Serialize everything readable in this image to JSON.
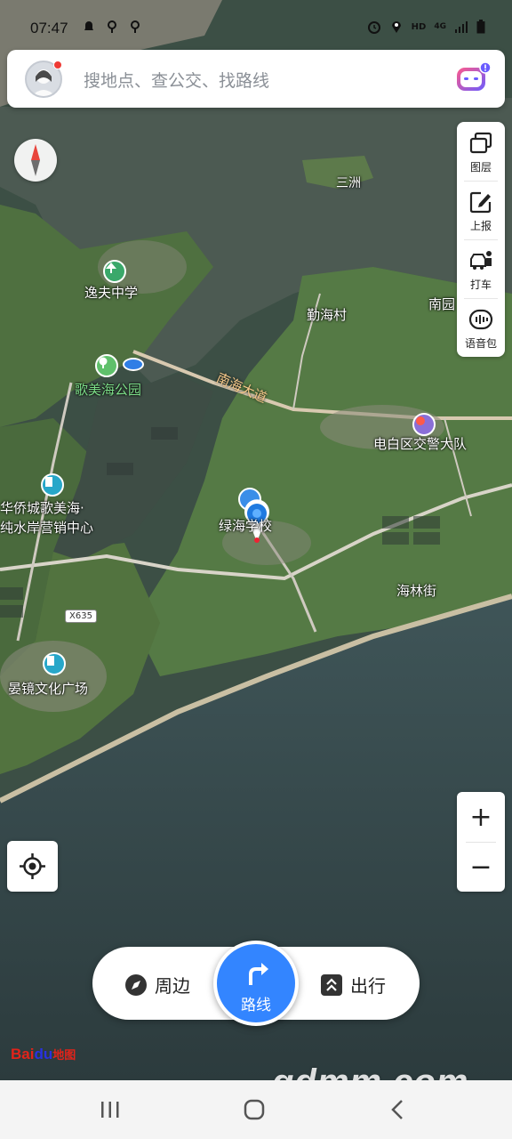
{
  "status_bar": {
    "time": "07:47",
    "left_icons": [
      "notification-icon",
      "location-pin-icon",
      "location-pin-icon"
    ],
    "right_icons": [
      "alarm-icon",
      "location-icon",
      "hd-icon",
      "4g-icon",
      "signal-icon",
      "battery-icon"
    ],
    "hd": "HD",
    "network": "4G"
  },
  "search": {
    "placeholder": "搜地点、查公交、找路线"
  },
  "toolbar": {
    "items": [
      {
        "label": "图层",
        "icon": "layers-icon"
      },
      {
        "label": "上报",
        "icon": "report-icon"
      },
      {
        "label": "打车",
        "icon": "taxi-icon"
      },
      {
        "label": "语音包",
        "icon": "voice-pack-icon"
      }
    ]
  },
  "map": {
    "labels": {
      "sanzhou": "三洲",
      "yifu_school": "逸夫中学",
      "qinhai_village": "勤海村",
      "nanyuan": "南园",
      "gemeihai_park": "歌美海公园",
      "nanhai_road": "南海大道",
      "traffic_police": "电白区交警大队",
      "huaqiao_line1": "华侨城歌美海·",
      "huaqiao_line2": "纯水岸营销中心",
      "lvhai_school": "绿海学校",
      "hailinjie": "海林街",
      "road_x635": "X635",
      "yanjing_plaza": "晏镜文化广场"
    }
  },
  "zoom": {
    "in": "+",
    "out": "−"
  },
  "bottom_bar": {
    "nearby": "周边",
    "route": "路线",
    "travel": "出行"
  },
  "brand": {
    "logo_text": "Bai",
    "logo_cn": "地图"
  },
  "watermark": "gdmm.com",
  "colors": {
    "accent": "#3385ff",
    "notification": "#ee3a34"
  }
}
